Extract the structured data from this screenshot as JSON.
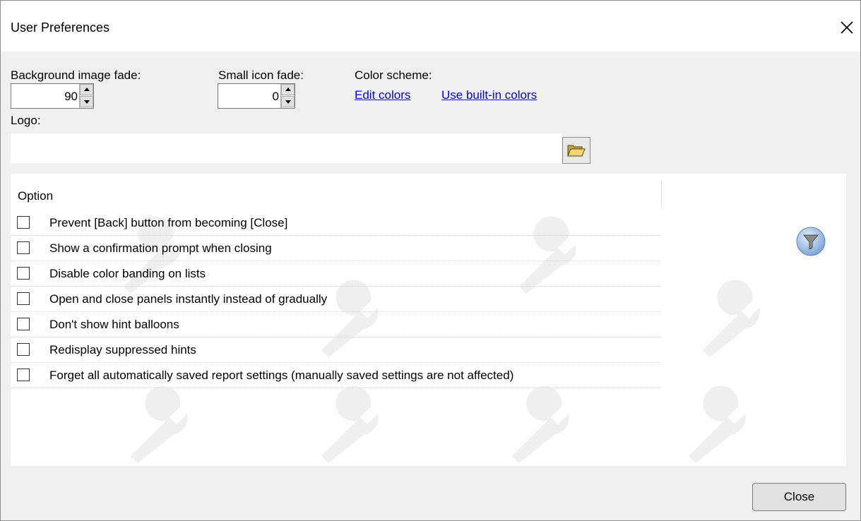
{
  "window": {
    "title": "User Preferences"
  },
  "fields": {
    "background_fade": {
      "label": "Background image fade:",
      "value": "90"
    },
    "icon_fade": {
      "label": "Small icon fade:",
      "value": "0"
    },
    "color_scheme": {
      "label": "Color scheme:",
      "edit_link": "Edit colors",
      "builtin_link": "Use built-in colors"
    },
    "logo": {
      "label": "Logo:",
      "value": ""
    }
  },
  "options": {
    "column_header": "Option",
    "items": [
      {
        "label": "Prevent [Back] button from becoming [Close]",
        "checked": false
      },
      {
        "label": "Show a confirmation prompt when closing",
        "checked": false
      },
      {
        "label": "Disable color banding on lists",
        "checked": false
      },
      {
        "label": "Open and close panels instantly instead of gradually",
        "checked": false
      },
      {
        "label": "Don't show hint balloons",
        "checked": false
      },
      {
        "label": "Redisplay suppressed hints",
        "checked": false
      },
      {
        "label": "Forget all automatically saved report settings (manually saved settings are not affected)",
        "checked": false
      }
    ]
  },
  "icons": {
    "close": "close-icon",
    "folder": "folder-open-icon",
    "filter": "filter-icon",
    "watermark": "wrench-icon"
  },
  "footer": {
    "close_label": "Close"
  }
}
